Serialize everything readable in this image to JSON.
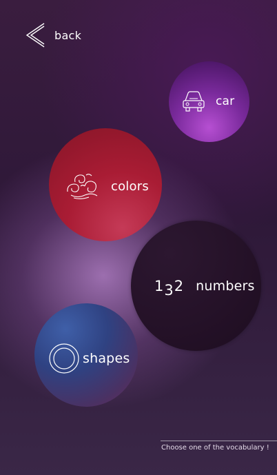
{
  "nav": {
    "back_label": "back"
  },
  "categories": [
    {
      "id": "car",
      "label": "car",
      "icon": "car-icon"
    },
    {
      "id": "colors",
      "label": "colors",
      "icon": "swirl-icon"
    },
    {
      "id": "numbers",
      "label": "numbers",
      "icon": "numbers-icon",
      "icon_text": [
        "1",
        "3",
        "2"
      ]
    },
    {
      "id": "shapes",
      "label": "shapes",
      "icon": "circle-shape-icon"
    }
  ],
  "footer": {
    "hint": "Choose one of the vocabulary !"
  },
  "colors": {
    "car": "#8b33ad",
    "colors": "#a91c34",
    "numbers": "#241127",
    "shapes": "#2f4282"
  }
}
